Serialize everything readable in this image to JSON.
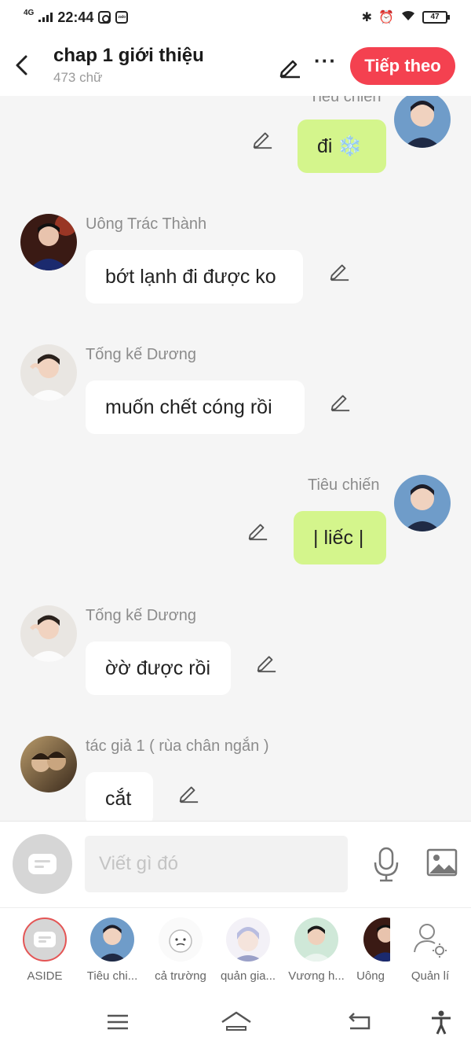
{
  "status_bar": {
    "network": "4G",
    "time": "22:44",
    "zalo_label": "zalo",
    "battery": "47"
  },
  "header": {
    "title": "chap 1 giới thiệu",
    "subtitle": "473 chữ",
    "next_label": "Tiếp theo"
  },
  "messages": [
    {
      "id": "m1",
      "sender": "Tiêu chiến",
      "text": "đi ❄️",
      "side": "right"
    },
    {
      "id": "m2",
      "sender": "Uông Trác Thành",
      "text": "bớt lạnh đi được ko",
      "side": "left"
    },
    {
      "id": "m3",
      "sender": "Tống kế Dương",
      "text": "muốn chết cóng rồi",
      "side": "left"
    },
    {
      "id": "m4",
      "sender": "Tiêu chiến",
      "text": "| liếc |",
      "side": "right"
    },
    {
      "id": "m5",
      "sender": "Tống kế Dương",
      "text": "ờờ được rồi",
      "side": "left"
    },
    {
      "id": "m6",
      "sender": "tác giả 1 ( rùa chân ngắn )",
      "text": "cắt",
      "side": "left"
    }
  ],
  "composer": {
    "placeholder": "Viết gì đó"
  },
  "characters": [
    {
      "label": "ASIDE"
    },
    {
      "label": "Tiêu chi..."
    },
    {
      "label": "cả trường"
    },
    {
      "label": "quản gia..."
    },
    {
      "label": "Vương h..."
    },
    {
      "label": "Uông"
    },
    {
      "label": "Quản lí"
    }
  ],
  "colors": {
    "accent": "#f44150",
    "own_bubble": "#d4f58c",
    "other_bubble": "#ffffff",
    "background": "#f5f5f5"
  }
}
